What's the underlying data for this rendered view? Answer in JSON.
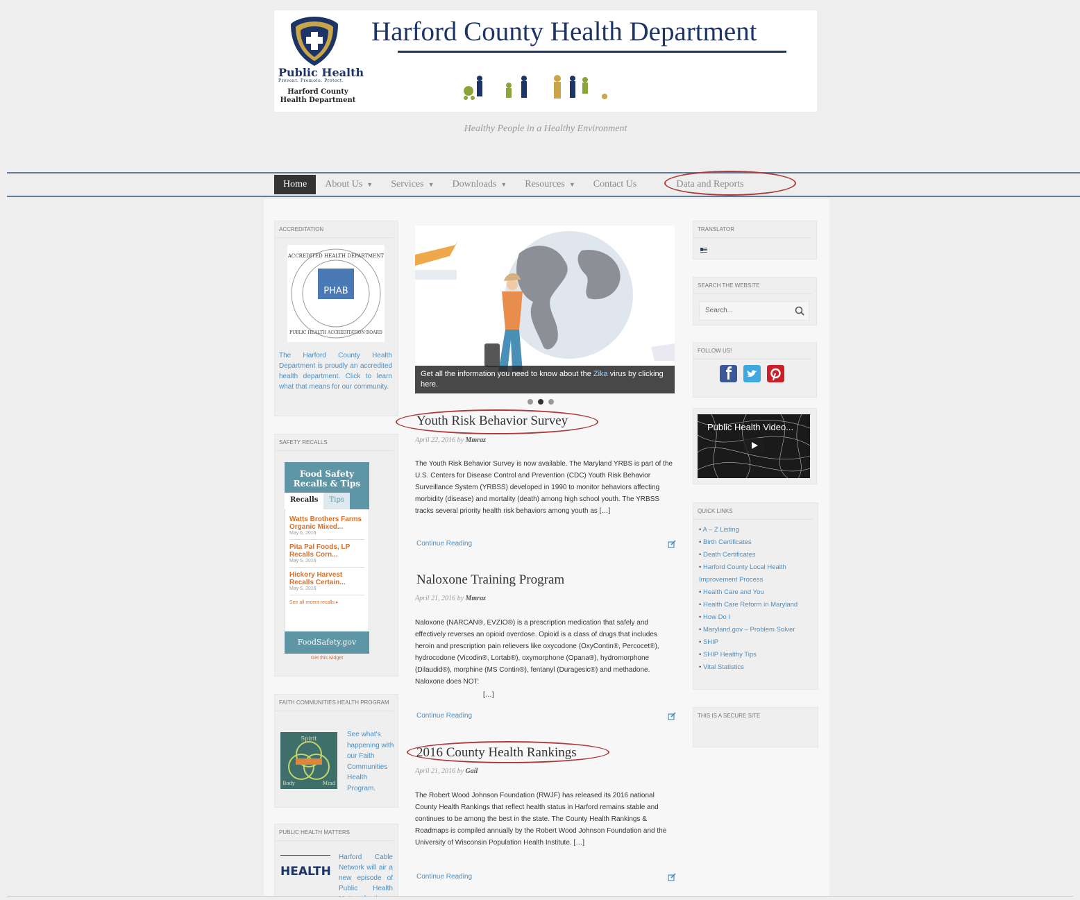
{
  "header": {
    "title": "Harford County Health Department",
    "logo_heading": "Public Health",
    "logo_sub": "Prevent. Promote. Protect.",
    "logo_org_line1": "Harford County",
    "logo_org_line2": "Health Department",
    "tagline": "Healthy People in a Healthy Environment"
  },
  "nav": {
    "items": [
      {
        "label": "Home",
        "active": true
      },
      {
        "label": "About Us",
        "dropdown": true
      },
      {
        "label": "Services",
        "dropdown": true
      },
      {
        "label": "Downloads",
        "dropdown": true
      },
      {
        "label": "Resources",
        "dropdown": true
      },
      {
        "label": "Contact Us"
      },
      {
        "label": "Data and Reports"
      }
    ],
    "caret": "▼"
  },
  "left_sidebar": {
    "accreditation": {
      "title": "ACCREDITATION",
      "badge_text": "PHAB",
      "badge_ring_top": "ACCREDITED HEALTH DEPARTMENT",
      "badge_ring_bottom": "PUBLIC HEALTH ACCREDITATION BOARD",
      "description": "The Harford County Health Department is proudly an accredited health department. Click to learn what that means for our community."
    },
    "safety_recalls": {
      "title": "SAFETY RECALLS",
      "widget_heading_1": "Food Safety",
      "widget_heading_2": "Recalls & Tips",
      "tab_recalls": "Recalls",
      "tab_tips": "Tips",
      "items": [
        {
          "title": "Watts Brothers Farms Organic Mixed...",
          "date": "May 6, 2016"
        },
        {
          "title": "Pita Pal Foods, LP Recalls Corn...",
          "date": "May 5, 2016"
        },
        {
          "title": "Hickory Harvest Recalls Certain...",
          "date": "May 5, 2016"
        }
      ],
      "see_all": "See all recent recalls ▸",
      "footer": "FoodSafety.gov",
      "get_widget": "Get this widget"
    },
    "faith": {
      "title": "FAITH COMMUNITIES HEALTH PROGRAM",
      "text": "See what's happening with our Faith Communities Health Program.",
      "img_top": "Spirit",
      "img_left": "Body",
      "img_right": "Mind"
    },
    "phm": {
      "title": "PUBLIC HEALTH MATTERS",
      "logo_text": "HEALTH",
      "text": "Harford Cable Network will air a new episode of Public Health Matters for the"
    }
  },
  "main": {
    "slider": {
      "caption_prefix": "Get all the information you need to know about the ",
      "caption_link": "Zika",
      "caption_suffix": " virus by clicking here.",
      "dot_count": 3,
      "active_dot": 1
    },
    "posts": [
      {
        "title": "Youth Risk Behavior Survey",
        "date": "April 22, 2016",
        "by": "by",
        "author": "Mmraz",
        "body": "The Youth Risk Behavior Survey is now available. The Maryland YRBS is part of the U.S. Centers for Disease Control and Prevention (CDC) Youth Risk Behavior Surveillance System (YRBSS) developed in 1990 to monitor behaviors affecting morbidity (disease) and mortality (death) among high school youth. The YRBSS tracks several priority health risk behaviors among youth as […]",
        "continue": "Continue Reading"
      },
      {
        "title": "Naloxone Training Program",
        "date": "April 21, 2016",
        "by": "by",
        "author": "Mmraz",
        "body": "Naloxone (NARCAN®, EVZIO®) is a prescription medication that safely and effectively reverses an opioid overdose. Opioid is a class of drugs that includes heroin and prescription pain relievers like oxycodone (OxyContin®, Percocet®), hydrocodone (Vicodin®, Lortab®), oxymorphone (Opana®), hydromorphone (Dilaudid®), morphine (MS Contin®), fentanyl (Duragesic®) and methadone. Naloxone does NOT:",
        "ellipsis": "[…]",
        "continue": "Continue Reading"
      },
      {
        "title": "2016 County Health Rankings",
        "date": "April 21, 2016",
        "by": "by",
        "author": "Gail",
        "body": "The Robert Wood Johnson Foundation (RWJF) has released its 2016 national County Health Rankings that reflect health status in Harford remains stable and continues to be among the best in the state. The County Health Rankings & Roadmaps is compiled annually by the Robert Wood Johnson Foundation and the University of Wisconsin Population Health Institute. […]",
        "continue": "Continue Reading"
      }
    ]
  },
  "right_sidebar": {
    "translator": {
      "title": "TRANSLATOR"
    },
    "search": {
      "title": "SEARCH THE WEBSITE",
      "placeholder": "Search..."
    },
    "follow": {
      "title": "FOLLOW US!"
    },
    "video": {
      "title": "Public Health Video..."
    },
    "quick_links": {
      "title": "QUICK LINKS",
      "items": [
        "A – Z Listing",
        "Birth Certificates",
        "Death Certificates",
        "Harford County Local Health Improvement Process",
        "Health Care and You",
        "Health Care Reform in Maryland",
        "How Do I",
        "Maryland.gov – Problem Solver",
        "SHIP",
        "SHIP Healthy Tips",
        "Vital Statistics"
      ]
    },
    "secure": {
      "title": "THIS IS A SECURE SITE"
    }
  },
  "colors": {
    "brand_navy": "#1c3566",
    "nav_line": "#5d7a99",
    "link_blue": "#4a8ec2",
    "annotation_red": "#b03a3a",
    "recall_orange": "#d8702a"
  }
}
